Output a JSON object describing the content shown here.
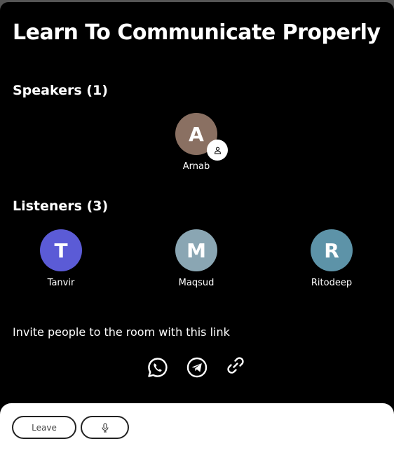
{
  "room": {
    "title": "Learn To Communicate Properly"
  },
  "speakers": {
    "heading": "Speakers (1)",
    "items": [
      {
        "initial": "A",
        "name": "Arnab",
        "color": "#8a7062",
        "badge_icon": "person-icon"
      }
    ]
  },
  "listeners": {
    "heading": "Listeners (3)",
    "items": [
      {
        "initial": "T",
        "name": "Tanvir",
        "color": "#5b5bd6"
      },
      {
        "initial": "M",
        "name": "Maqsud",
        "color": "#8aa6b3"
      },
      {
        "initial": "R",
        "name": "Ritodeep",
        "color": "#5d93a8"
      }
    ]
  },
  "invite": {
    "text": "Invite people to the room with this link",
    "share_icons": [
      "whatsapp-icon",
      "telegram-icon",
      "link-icon"
    ]
  },
  "footer": {
    "leave_label": "Leave",
    "mic_icon": "microphone-icon"
  },
  "colors": {
    "background": "#000000",
    "footer": "#ffffff",
    "text": "#ffffff"
  }
}
